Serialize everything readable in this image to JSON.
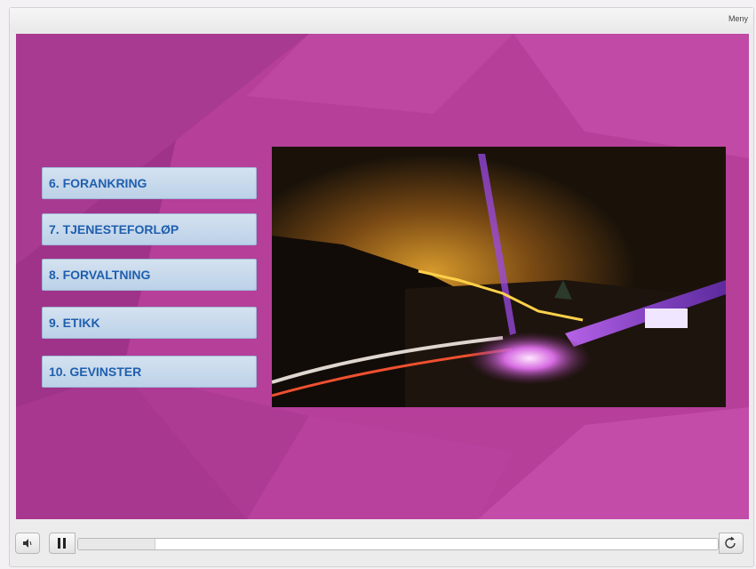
{
  "player": {
    "menu_label": "Meny",
    "progress": 0.12
  },
  "slide": {
    "nav_items": [
      {
        "label": "6. FORANKRING"
      },
      {
        "label": "7. TJENESTEFORLØP"
      },
      {
        "label": "8. FORVALTNING"
      },
      {
        "label": "9. ETIKK"
      },
      {
        "label": "10. GEVINSTER"
      }
    ],
    "photo": {
      "description_icon": "night-landscape-photo-icon"
    }
  },
  "colors": {
    "slide_background": "#b43f98",
    "button_text": "#1f5fae",
    "button_fill": "#c8d9ec"
  },
  "icons": {
    "volume": "speaker-icon",
    "play_pause": "pause-icon",
    "replay": "replay-icon"
  }
}
